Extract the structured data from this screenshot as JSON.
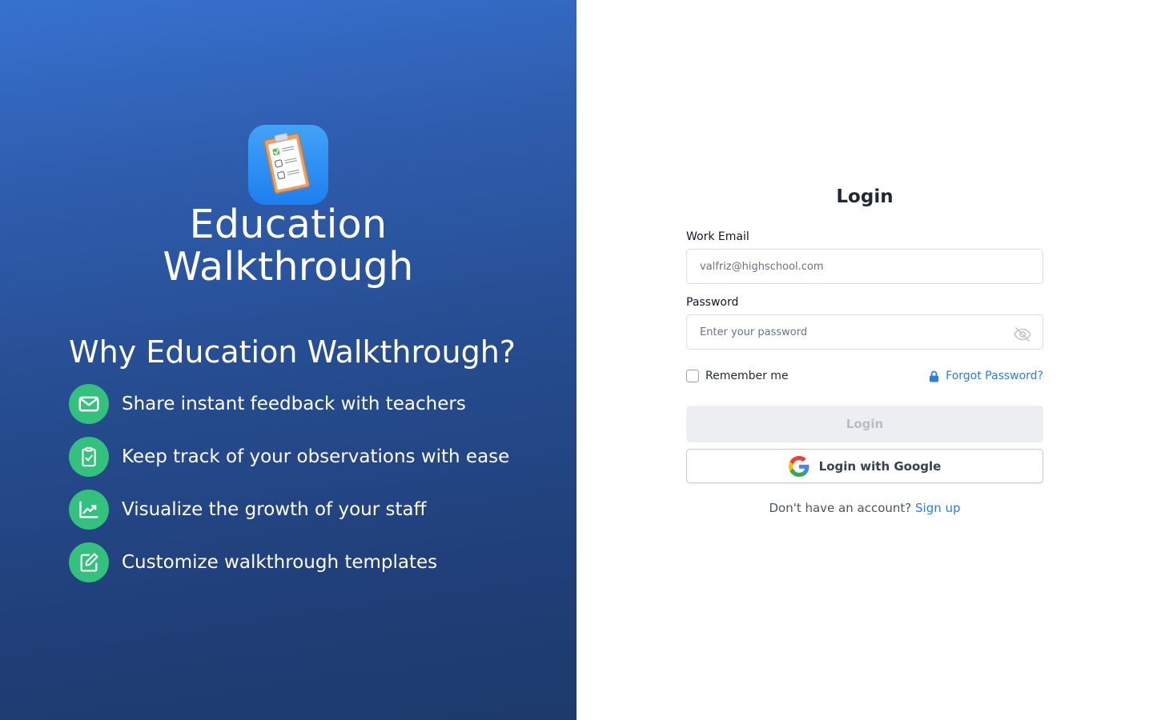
{
  "brand": {
    "title_line1": "Education",
    "title_line2": "Walkthrough"
  },
  "promo": {
    "heading": "Why Education Walkthrough?",
    "features": [
      {
        "icon": "mail-icon",
        "label": "Share instant feedback with teachers"
      },
      {
        "icon": "clipboard-check-icon",
        "label": "Keep track of your observations with ease"
      },
      {
        "icon": "growth-chart-icon",
        "label": "Visualize the growth of your staff"
      },
      {
        "icon": "edit-template-icon",
        "label": "Customize walkthrough templates"
      }
    ]
  },
  "login": {
    "title": "Login",
    "email_label": "Work Email",
    "email_placeholder": "valfriz@highschool.com",
    "email_value": "",
    "password_label": "Password",
    "password_placeholder": "Enter your password",
    "password_value": "",
    "remember_label": "Remember me",
    "remember_checked": false,
    "forgot_label": "Forgot Password?",
    "submit_label": "Login",
    "google_label": "Login with Google",
    "signup_prompt": "Don't have an account? ",
    "signup_label": "Sign up"
  },
  "colors": {
    "panel_gradient_top": "#3772d0",
    "panel_gradient_bottom": "#1e3a6c",
    "feature_icon_bg": "#34c17e",
    "link": "#2f7bea",
    "disabled_button_bg": "#eceef1"
  }
}
